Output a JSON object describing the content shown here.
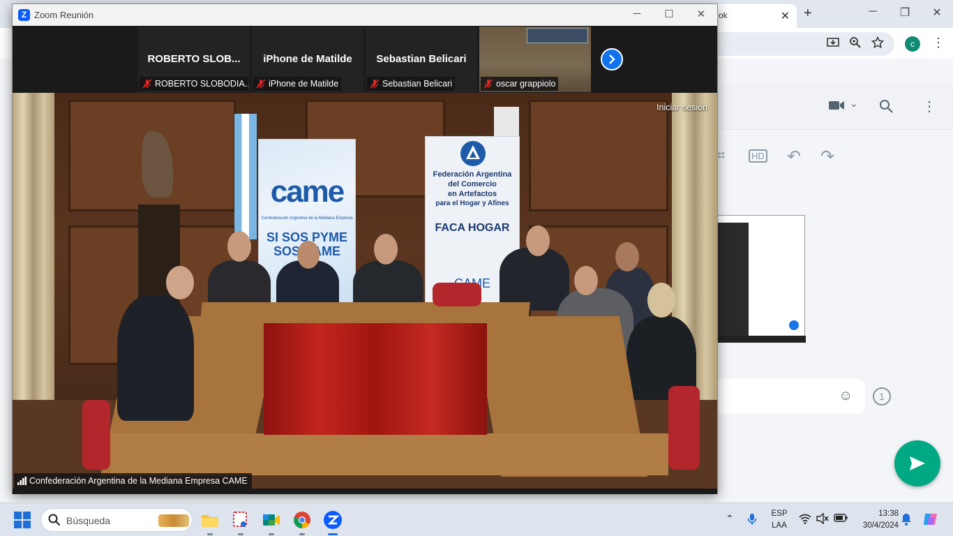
{
  "chrome": {
    "tab_title": "ok",
    "tab_close": "✕",
    "new_tab": "+",
    "profile_initial": "c",
    "window_controls": [
      "─",
      "❐",
      "✕"
    ]
  },
  "zoom": {
    "window_title": "Zoom Reunión",
    "window_controls": [
      "─",
      "☐",
      "✕"
    ],
    "participants": [
      {
        "name": "ROBERTO SLOB...",
        "label": "ROBERTO SLOBODIA..."
      },
      {
        "name": "iPhone de Matilde",
        "label": "iPhone de Matilde"
      },
      {
        "name": "Sebastian Belicari",
        "label": "Sebastian Belicari"
      },
      {
        "name": "",
        "label": "oscar grappiolo"
      }
    ],
    "signin_label": "Iniciar sesión",
    "active_speaker": "Confederación Argentina de la Mediana Empresa CAME",
    "banners": {
      "came_logo": "came",
      "came_tagline": "Confederación Argentina de la Mediana Empresa",
      "came_slogan_1": "SI SOS PYME",
      "came_slogan_2": "SOS CAME",
      "faca_1": "Federación Argentina",
      "faca_2": "del Comercio",
      "faca_3": "en Artefactos",
      "faca_4": "para el Hogar y Afines",
      "faca_5": "FACA HOGAR",
      "faca_6": "CAME"
    }
  },
  "taskbar": {
    "search_placeholder": "Búsqueda",
    "language": "ESP",
    "layout": "LAA",
    "time": "13:38",
    "date": "30/4/2024"
  },
  "whatsapp": {
    "once_label": "1"
  },
  "colors": {
    "zoom_blue": "#0e72ed",
    "whatsapp_green": "#00a884",
    "mute_red": "#e02828"
  }
}
